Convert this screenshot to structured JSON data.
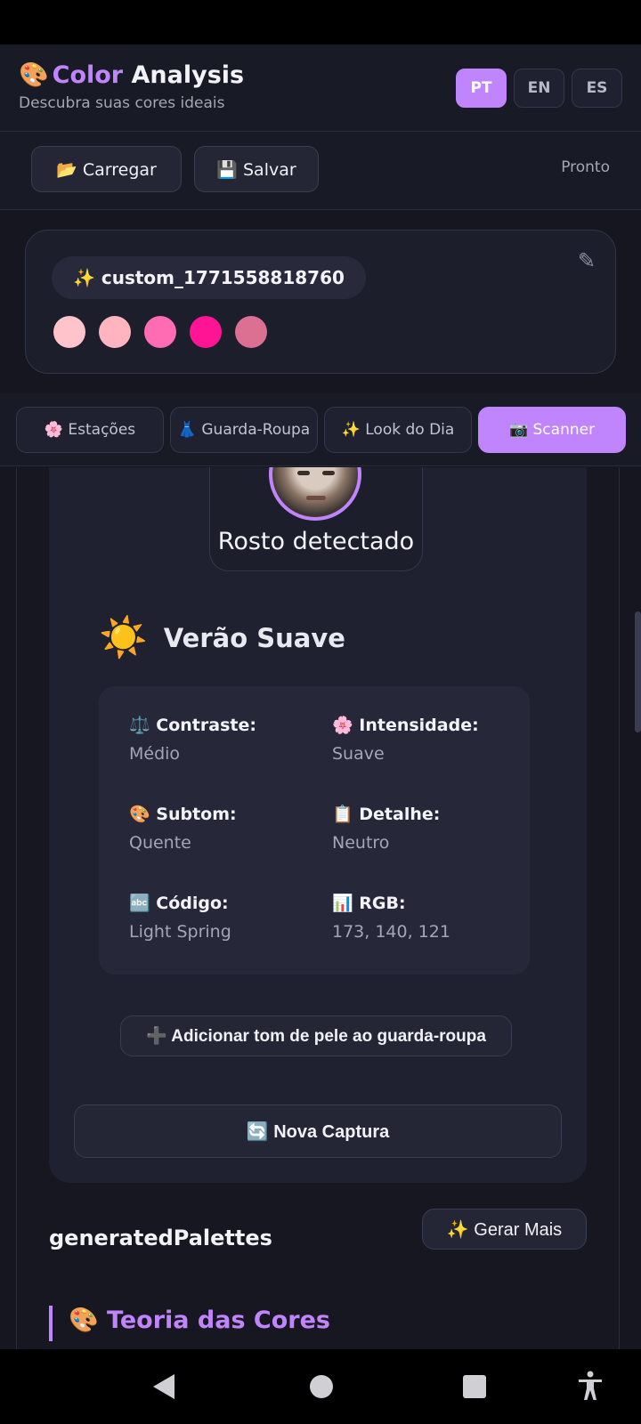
{
  "header": {
    "brand_emoji": "🎨",
    "brand_accent": "Color",
    "brand_rest": "Analysis",
    "subtitle": "Descubra suas cores ideais",
    "languages": [
      "PT",
      "EN",
      "ES"
    ],
    "active_language": "PT"
  },
  "toolbar": {
    "load_label": "📂 Carregar",
    "save_label": "💾 Salvar",
    "status": "Pronto"
  },
  "palette": {
    "name": "✨ custom_1771558818760",
    "edit_icon": "✎",
    "swatches": [
      "#ffc3cb",
      "#ffb4c0",
      "#ff6cb4",
      "#ff1493",
      "#db7093"
    ]
  },
  "tabs": [
    {
      "label": "🌸 Estações",
      "active": false
    },
    {
      "label": "👗 Guarda-Roupa",
      "active": false
    },
    {
      "label": "✨ Look do Dia",
      "active": false
    },
    {
      "label": "📷 Scanner",
      "active": true
    }
  ],
  "scanner": {
    "face_label": "Rosto detectado",
    "season_icon": "☀️",
    "season_name": "Verão Suave",
    "details": {
      "contrast_label": "⚖️ Contraste:",
      "contrast_value": "Médio",
      "intensity_label": "🌸 Intensidade:",
      "intensity_value": "Suave",
      "undertone_label": "🎨 Subtom:",
      "undertone_value": "Quente",
      "detail_label": "📋 Detalhe:",
      "detail_value": "Neutro",
      "code_label": "🔤 Código:",
      "code_value": "Light Spring",
      "rgb_label": "📊 RGB:",
      "rgb_value": "173, 140, 121"
    },
    "add_skin_label": "➕ Adicionar tom de pele ao guarda-roupa",
    "new_capture_label": "🔄 Nova Captura"
  },
  "generated": {
    "title": "generatedPalettes",
    "more_label": "✨ Gerar Mais"
  },
  "theory": {
    "title": "🎨 Teoria das Cores"
  },
  "colors": {
    "accent": "#c084fc",
    "background": "#15161f",
    "card": "#1f2130"
  }
}
